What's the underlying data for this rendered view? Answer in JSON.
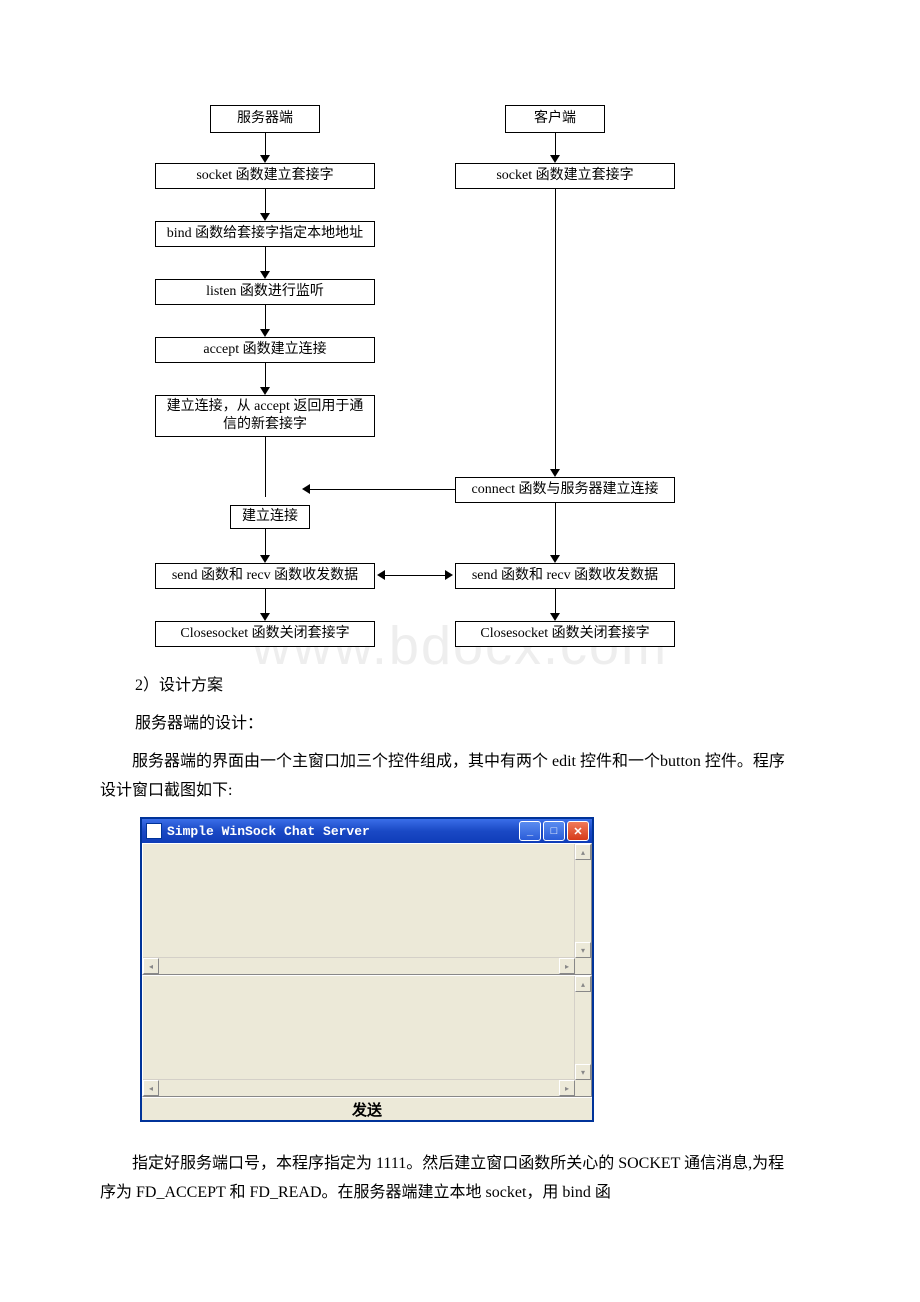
{
  "flow": {
    "server_header": "服务器端",
    "client_header": "客户端",
    "server_boxes": {
      "socket": "socket 函数建立套接字",
      "bind": "bind 函数给套接字指定本地地址",
      "listen": "listen 函数进行监听",
      "accept": "accept 函数建立连接",
      "newsock": "建立连接，从 accept 返回用于通信的新套接字",
      "connect_label": "建立连接",
      "sendrecv": "send 函数和 recv 函数收发数据",
      "close": "Closesocket 函数关闭套接字"
    },
    "client_boxes": {
      "socket": "socket 函数建立套接字",
      "connect": "connect 函数与服务器建立连接",
      "sendrecv": "send 函数和 recv 函数收发数据",
      "close": "Closesocket 函数关闭套接字"
    }
  },
  "text": {
    "section2_heading": "2）设计方案",
    "server_design_heading": "服务器端的设计：",
    "para1": "服务器端的界面由一个主窗口加三个控件组成，其中有两个 edit 控件和一个button 控件。程序设计窗口截图如下:",
    "para2": "指定好服务端口号，本程序指定为 1111。然后建立窗口函数所关心的 SOCKET 通信消息,为程序为 FD_ACCEPT 和 FD_READ。在服务器端建立本地 socket，用 bind 函"
  },
  "xpwindow": {
    "title": "Simple WinSock Chat Server",
    "send_label": "发送"
  },
  "watermark": "www.bdocx.com"
}
